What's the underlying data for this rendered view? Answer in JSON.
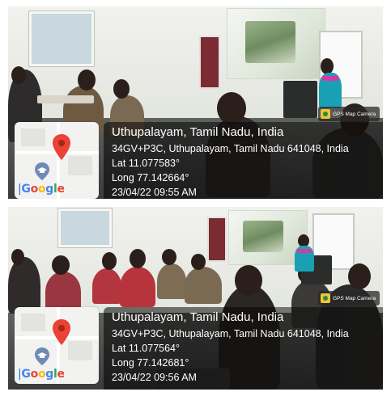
{
  "photos": [
    {
      "address_title": "Uthupalayam, Tamil Nadu, India",
      "plus_code_line": "34GV+P3C, Uthupalayam, Tamil Nadu 641048, India",
      "lat": "Lat 11.077583°",
      "long": "Long 77.142664°",
      "timestamp": "23/04/22 09:55 AM",
      "badge_label": "GPS Map Camera",
      "google_parts": [
        "G",
        "o",
        "o",
        "g",
        "l",
        "e"
      ]
    },
    {
      "address_title": "Uthupalayam, Tamil Nadu, India",
      "plus_code_line": "34GV+P3C, Uthupalayam, Tamil Nadu 641048, India",
      "lat": "Lat 11.077564°",
      "long": "Long 77.142681°",
      "timestamp": "23/04/22 09:56 AM",
      "badge_label": "GPS Map Camera",
      "google_parts": [
        "G",
        "o",
        "o",
        "g",
        "l",
        "e"
      ]
    }
  ],
  "icons": {
    "map_pin": "map-pin-icon",
    "education": "graduation-cap-icon",
    "camera": "gps-camera-icon"
  },
  "colors": {
    "pin_red": "#ea4335",
    "overlay_bg": "rgba(0,0,0,0.5)",
    "teacher_top": "#1aa0b5",
    "teacher_sari": "#d63aa0"
  }
}
